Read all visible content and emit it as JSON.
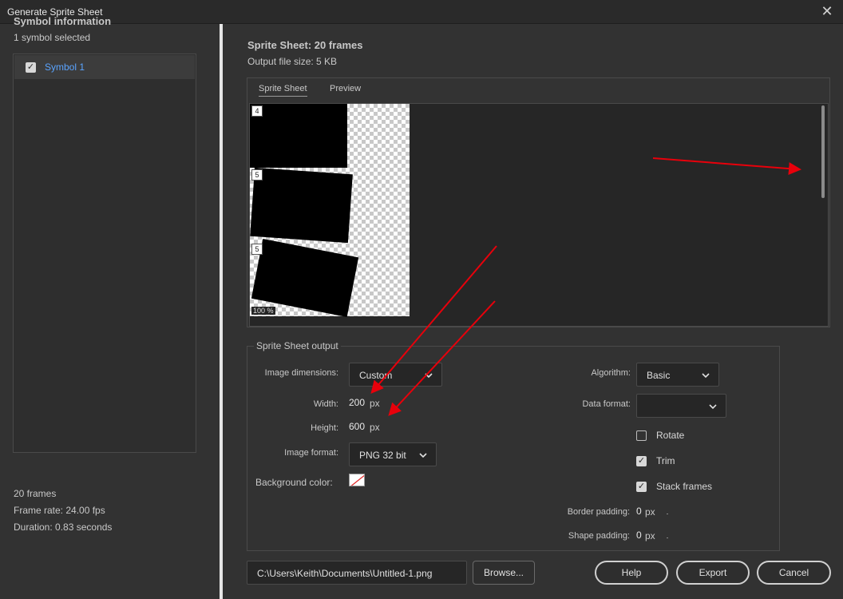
{
  "window": {
    "title": "Generate Sprite Sheet"
  },
  "symbol_panel": {
    "heading": "Symbol information",
    "selected_count": "1 symbol selected",
    "items": [
      {
        "label": "Symbol 1",
        "checked": true
      }
    ],
    "frames": "20 frames",
    "frame_rate": "Frame rate: 24.00 fps",
    "duration": "Duration: 0.83 seconds"
  },
  "summary": {
    "title": "Sprite Sheet: 20 frames",
    "file_size": "Output file size: 5 KB"
  },
  "tabs": [
    {
      "label": "Sprite Sheet",
      "active": true
    },
    {
      "label": "Preview",
      "active": false
    }
  ],
  "canvas": {
    "zoom": "100 %",
    "frame_numbers": [
      "4",
      "5",
      "5"
    ]
  },
  "output": {
    "legend": "Sprite Sheet output",
    "image_dimensions_label": "Image dimensions:",
    "image_dimensions_value": "Custom",
    "width_label": "Width:",
    "width_value": "200",
    "height_label": "Height:",
    "height_value": "600",
    "px": "px",
    "image_format_label": "Image format:",
    "image_format_value": "PNG 32 bit",
    "background_color_label": "Background color:",
    "algorithm_label": "Algorithm:",
    "algorithm_value": "Basic",
    "data_format_label": "Data format:",
    "data_format_value": "",
    "rotate_label": "Rotate",
    "rotate_checked": false,
    "trim_label": "Trim",
    "trim_checked": true,
    "stack_label": "Stack frames",
    "stack_checked": true,
    "border_padding_label": "Border padding:",
    "border_padding_value": "0",
    "shape_padding_label": "Shape padding:",
    "shape_padding_value": "0"
  },
  "footer": {
    "path": "C:\\Users\\Keith\\Documents\\Untitled-1.png",
    "browse": "Browse...",
    "help": "Help",
    "export": "Export",
    "cancel": "Cancel"
  },
  "colors": {
    "accent_blue": "#5aa4ff",
    "annotation_red": "#e8000b"
  }
}
